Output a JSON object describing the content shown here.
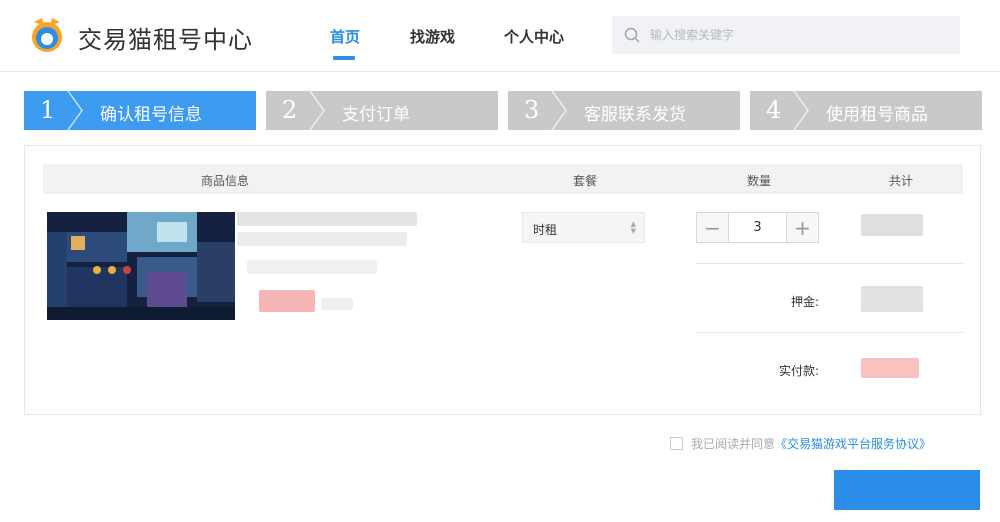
{
  "header": {
    "brand": "交易猫租号中心",
    "nav": [
      {
        "label": "首页",
        "active": true
      },
      {
        "label": "找游戏",
        "active": false
      },
      {
        "label": "个人中心",
        "active": false
      }
    ],
    "search_placeholder": "输入搜索关键字"
  },
  "steps": [
    {
      "num": "1",
      "label": "确认租号信息",
      "active": true
    },
    {
      "num": "2",
      "label": "支付订单",
      "active": false
    },
    {
      "num": "3",
      "label": "客服联系发货",
      "active": false
    },
    {
      "num": "4",
      "label": "使用租号商品",
      "active": false
    }
  ],
  "table": {
    "headers": {
      "product": "商品信息",
      "package": "套餐",
      "quantity": "数量",
      "total": "共计"
    }
  },
  "order": {
    "package": "时租",
    "quantity": "3",
    "deposit_label": "押金:",
    "paid_label": "实付款:"
  },
  "footer": {
    "agree_text": "我已阅读并同意",
    "agree_link": "《交易猫游戏平台服务协议》"
  },
  "colors": {
    "accent": "#2b8de8",
    "step_active": "#3d9bf0",
    "step_inactive": "#c9c9c9"
  }
}
